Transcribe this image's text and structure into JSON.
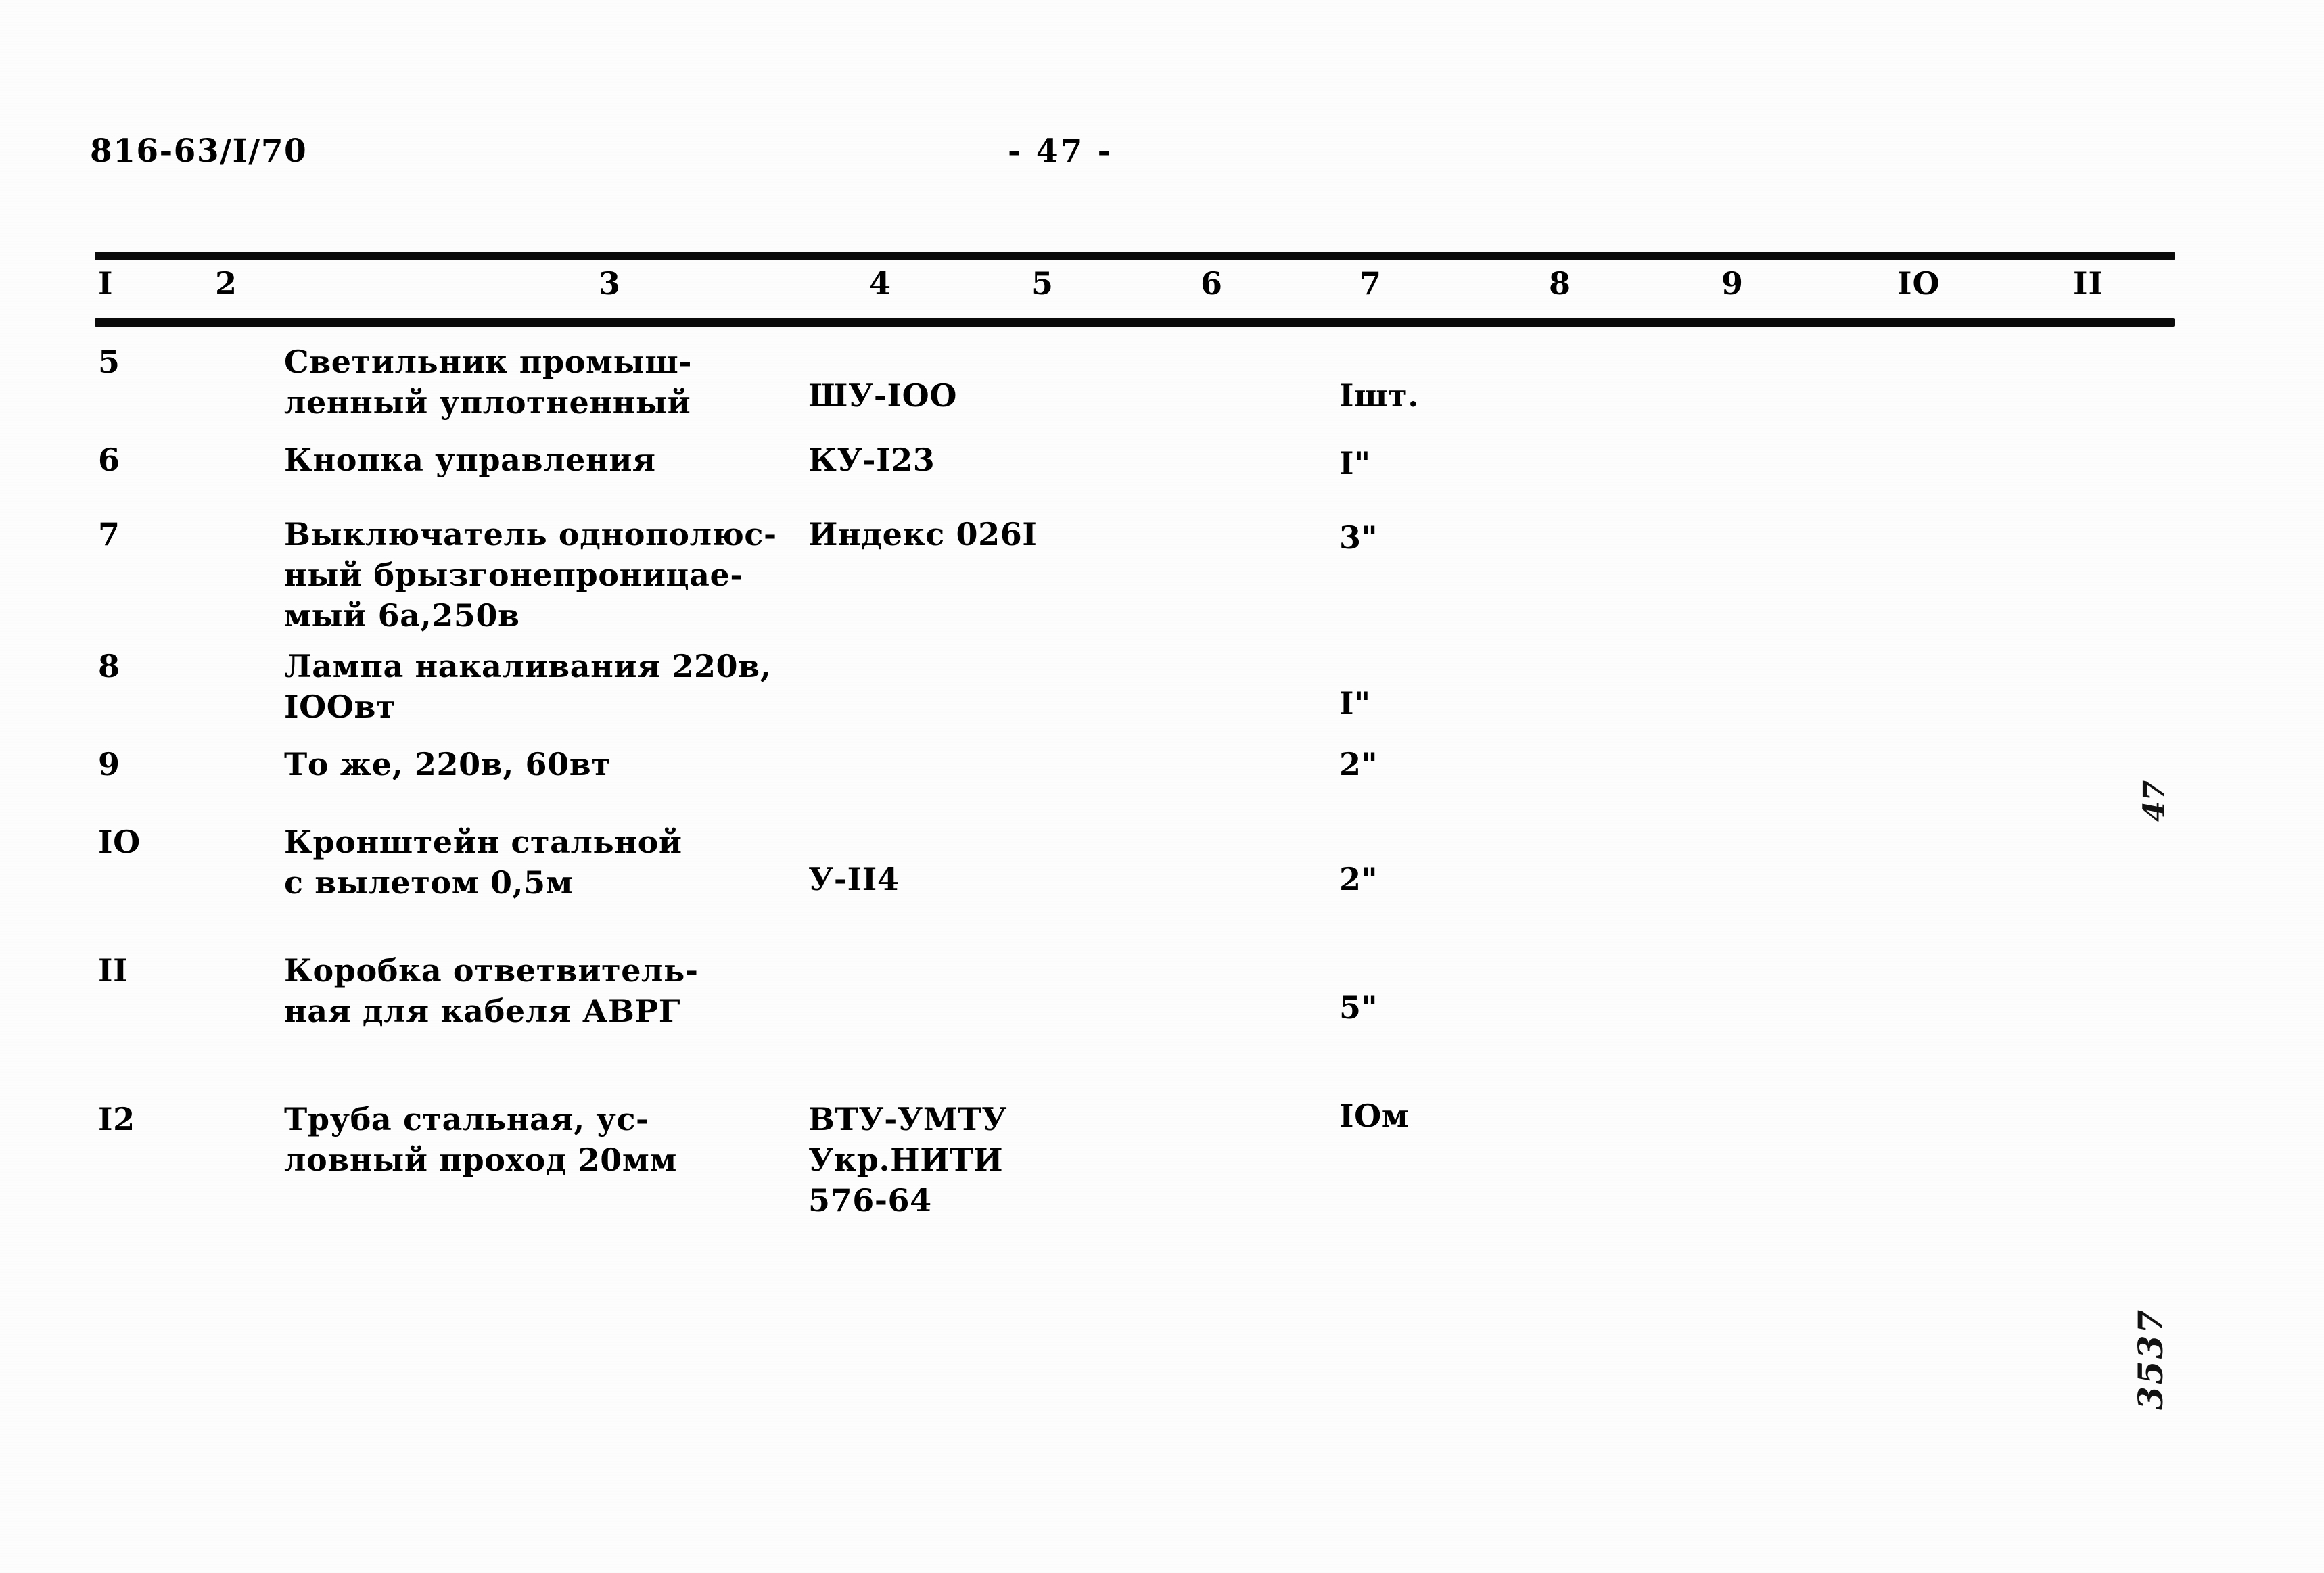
{
  "header": {
    "doc_code": "816-63/I/70",
    "page_marker": "- 47 -"
  },
  "table": {
    "column_headers": [
      "I",
      "2",
      "3",
      "4",
      "5",
      "6",
      "7",
      "8",
      "9",
      "IO",
      "II"
    ],
    "rows": [
      {
        "num": "5",
        "name": "Светильник промыш-\nленный уплотненный",
        "mark": "ШУ-IOO",
        "qty": "Iшт."
      },
      {
        "num": "6",
        "name": "Кнопка управления",
        "mark": "КУ-I23",
        "qty": "I\""
      },
      {
        "num": "7",
        "name": "Выключатель однополюс-\nный брызгонепроницае-\nмый 6а,250в",
        "mark": "Индекс 026I",
        "qty": "3\""
      },
      {
        "num": "8",
        "name": "Лампа накаливания 220в,\nIOOвт",
        "mark": "",
        "qty": "I\""
      },
      {
        "num": "9",
        "name": "То же, 220в, 60вт",
        "mark": "",
        "qty": "2\""
      },
      {
        "num": "IO",
        "name": "Кронштейн стальной\nс вылетом 0,5м",
        "mark": "У-II4",
        "qty": "2\""
      },
      {
        "num": "II",
        "name": "Коробка ответвитель-\nная для кабеля АВРГ",
        "mark": "",
        "qty": "5\""
      },
      {
        "num": "I2",
        "name": "Труба стальная, ус-\nловный проход 20мм",
        "mark": "ВТУ-УМТУ\nУкр.НИТИ\n576-64",
        "qty": "IOм"
      }
    ]
  },
  "margin_notes": {
    "page_hand": "47",
    "archive_hand": "3537"
  }
}
